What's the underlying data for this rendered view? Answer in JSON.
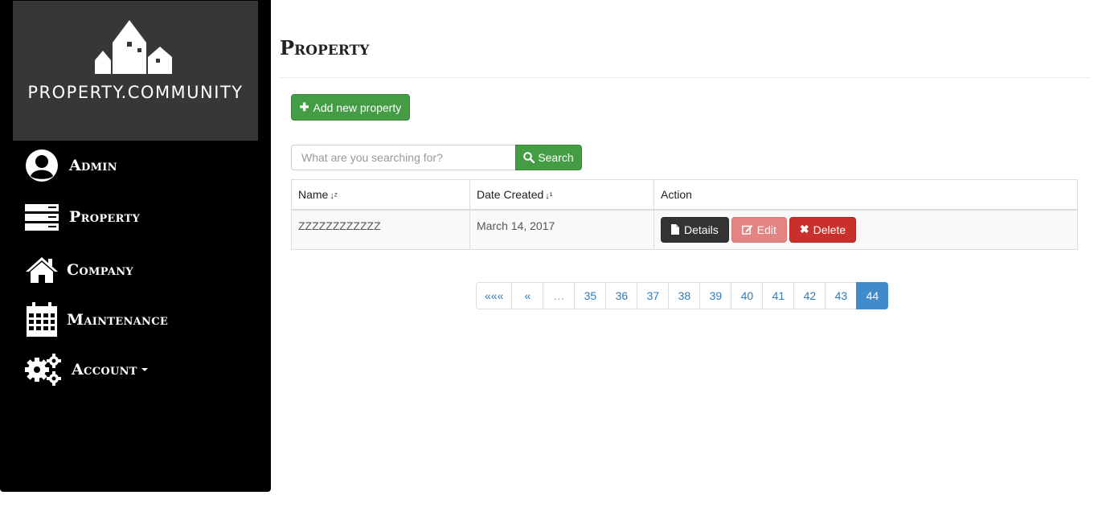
{
  "brand": {
    "logo_text": "PROPERTY.COMMUNITY"
  },
  "sidebar": {
    "items": [
      {
        "label": "Admin",
        "icon": "user-circle-icon"
      },
      {
        "label": "Property",
        "icon": "server-stack-icon"
      },
      {
        "label": "Company",
        "icon": "home-icon"
      },
      {
        "label": "Maintenance",
        "icon": "calendar-icon"
      },
      {
        "label": "Account",
        "icon": "gears-icon"
      }
    ]
  },
  "main": {
    "title": "Property",
    "add_button": "Add new property",
    "search": {
      "placeholder": "What are you searching for?",
      "button": "Search"
    },
    "table": {
      "headers": [
        "Name",
        "Date Created",
        "Action"
      ],
      "rows": [
        {
          "name": "ZZZZZZZZZZZZ",
          "date": "March 14, 2017"
        }
      ],
      "actions": {
        "details": "Details",
        "edit": "Edit",
        "delete": "Delete"
      }
    },
    "pagination": {
      "first": "«««",
      "prev": "«",
      "ellipsis": "…",
      "pages": [
        "35",
        "36",
        "37",
        "38",
        "39",
        "40",
        "41",
        "42",
        "43",
        "44"
      ],
      "active": "44"
    }
  },
  "colors": {
    "sidebar_bg": "#000000",
    "logo_bg": "#383637",
    "success": "#449d44",
    "dark": "#333333",
    "danger": "#c9302c",
    "link": "#337ab7",
    "active_page": "#428bca"
  }
}
